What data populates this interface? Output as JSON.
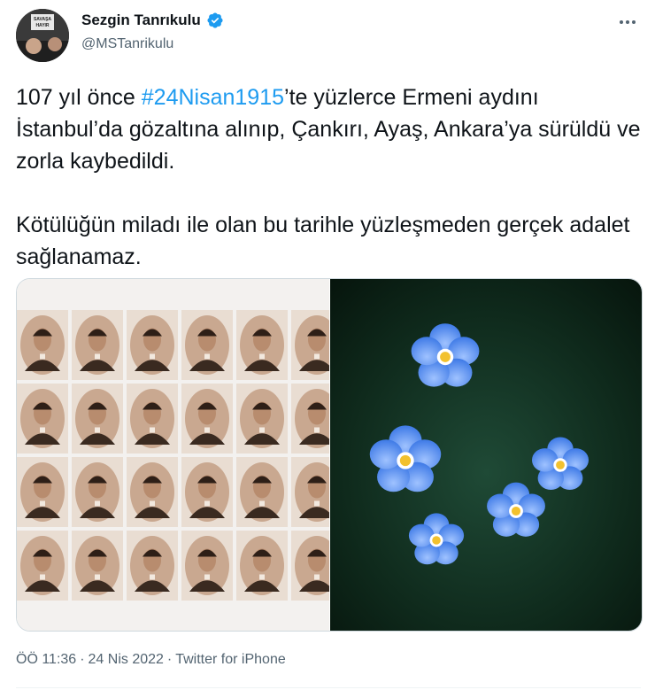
{
  "author": {
    "name": "Sezgin Tanrıkulu",
    "handle": "@MSTanrikulu",
    "avatar_sign_text": "SAVAŞA HAYIR"
  },
  "tweet": {
    "line1_before": "107 yıl önce ",
    "hashtag": "#24Nisan1915",
    "line1_after": "’te yüzlerce Ermeni aydını İstanbul’da gözaltına alınıp, Çankırı, Ayaş, Ankara’ya sürüldü ve zorla kaybedildi.",
    "paragraph2": "Kötülüğün miladı ile olan bu tarihle yüzleşmeden gerçek adalet sağlanamaz."
  },
  "footer": {
    "time": "ÖÖ 11:36",
    "sep1": "·",
    "date": "24 Nis 2022",
    "sep2": "·",
    "source": "Twitter for iPhone"
  },
  "colors": {
    "link": "#1d9bf0",
    "verified": "#1d9bf0",
    "secondary_text": "#536471"
  },
  "icons": {
    "verified": "verified-badge-icon",
    "more": "more-options-icon"
  }
}
